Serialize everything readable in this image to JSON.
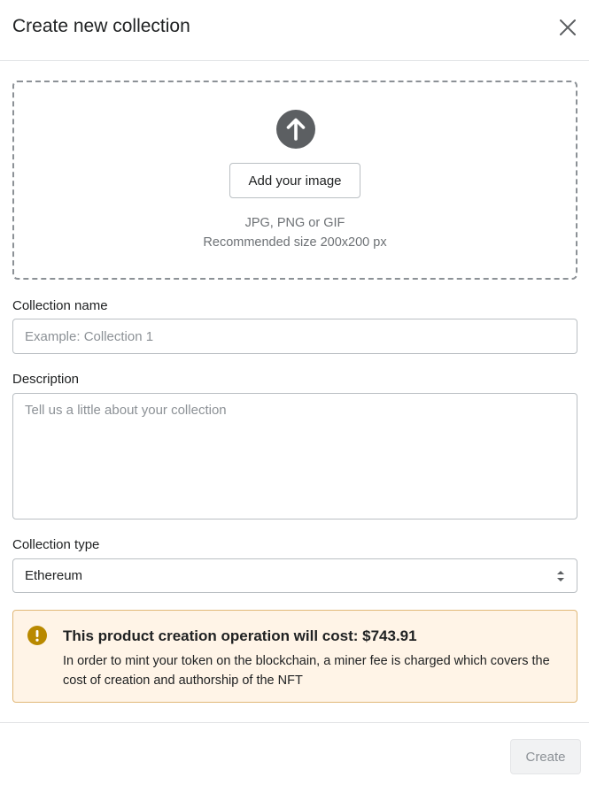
{
  "modal": {
    "title": "Create new collection",
    "close_icon": "close-icon"
  },
  "upload": {
    "icon": "arrow-up-circle-icon",
    "button_label": "Add your image",
    "formats_hint": "JPG, PNG or GIF",
    "size_hint": "Recommended size 200x200 px"
  },
  "form": {
    "name": {
      "label": "Collection name",
      "value": "",
      "placeholder": "Example: Collection 1"
    },
    "description": {
      "label": "Description",
      "value": "",
      "placeholder": "Tell us a little about your collection"
    },
    "type": {
      "label": "Collection type",
      "selected": "Ethereum",
      "icon": "select-arrows-icon"
    }
  },
  "notice": {
    "icon": "warning-icon",
    "title": "This product creation operation will cost: $743.91",
    "text": "In order to mint your token on the blockchain, a miner fee is charged which covers the cost of creation and authorship of the NFT"
  },
  "footer": {
    "create_label": "Create",
    "create_disabled": true
  },
  "colors": {
    "banner_bg": "#fff4e7",
    "banner_border": "#e1b878",
    "warning": "#b98900",
    "upload_icon": "#5c5f62"
  }
}
